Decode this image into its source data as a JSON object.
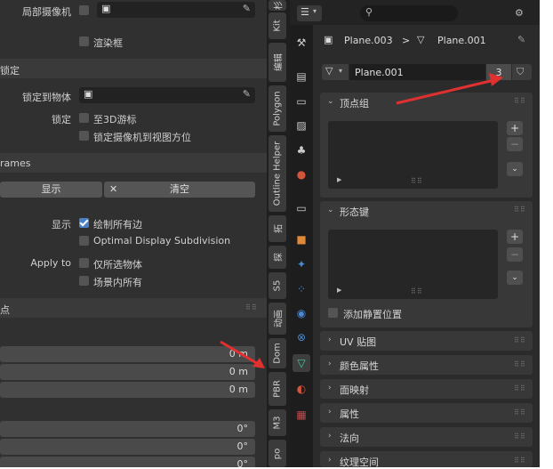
{
  "left_panel": {
    "local_camera_label": "局部摄像机",
    "render_border_label": "渲染框",
    "lock_header": "锁定",
    "lock_to_object_label": "锁定到物体",
    "lock_label": "锁定",
    "to_3d_cursor_label": "至3D游标",
    "lock_camera_to_view_label": "锁定摄像机到视图方位",
    "frames_header": "rames",
    "display_button": "显示",
    "clear_button": "清空",
    "display_label": "显示",
    "draw_all_edges_label": "绘制所有边",
    "optimal_display_label": "Optimal Display Subdivision",
    "apply_to_label": "Apply to",
    "only_selected_label": "仅所选物体",
    "scene_all_label": "场景内所有",
    "partial_header": "点",
    "value_rows": [
      "0 m",
      "0 m",
      "0 m"
    ],
    "angle_rows": [
      "0°",
      "0°",
      "0°"
    ]
  },
  "tabs": [
    "杉",
    "Kit",
    "编辑",
    "Polygon",
    "Outline Helper",
    "拓",
    "探",
    "S5",
    "动画",
    "Dom",
    "PBR",
    "M3",
    "po"
  ],
  "props": {
    "search_placeholder": "",
    "breadcrumb_object": "Plane.003",
    "breadcrumb_separator": ">",
    "breadcrumb_mesh": "Plane.001",
    "mesh_name": "Plane.001",
    "user_count": "3",
    "vertex_groups_title": "顶点组",
    "shape_keys_title": "形态键",
    "add_rest_position_label": "添加静置位置",
    "collapsed_sections": [
      "UV 贴图",
      "颜色属性",
      "面映射",
      "属性",
      "法向",
      "纹理空间"
    ],
    "plus_label": "+",
    "minus_label": "−"
  }
}
